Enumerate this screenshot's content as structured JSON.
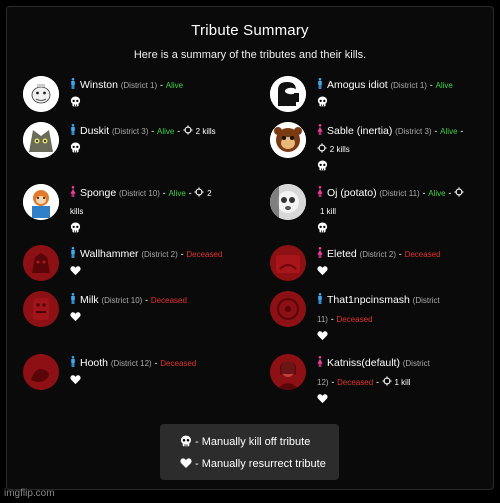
{
  "title": "Tribute Summary",
  "subtitle": "Here is a summary of the tributes and their kills.",
  "colors": {
    "alive": "#3fcf4a",
    "deceased": "#e23232",
    "male": "#3fa9f5",
    "female": "#f03c9a"
  },
  "tributes": [
    {
      "name": "Winston",
      "district": "(District 1)",
      "dash": "-",
      "status": "Alive",
      "dash2": "",
      "kills": "",
      "gender": "male",
      "icon": "skull-icon"
    },
    {
      "name": "Amogus idiot",
      "district": "(District 1)",
      "dash": "-",
      "status": "Alive",
      "dash2": "",
      "kills": "",
      "gender": "male",
      "icon": "skull-icon"
    },
    {
      "name": "Duskit",
      "district": "(District 3)",
      "dash": "-",
      "status": "Alive",
      "dash2": "-",
      "kills": "2 kills",
      "gender": "male",
      "icon": "skull-icon"
    },
    {
      "name": "Sable (inertia)",
      "district": "(District 3)",
      "dash": "-",
      "status": "Alive",
      "dash2": "-",
      "kills": "2 kills",
      "gender": "female",
      "icon": "skull-icon"
    },
    {
      "name": "Sponge",
      "district": "(District 10)",
      "dash": "-",
      "status": "Alive",
      "dash2": "-",
      "kills_a": "2",
      "kills_b": "kills",
      "gender": "female",
      "icon": "skull-icon"
    },
    {
      "name": "Oj (potato)",
      "district": "(District 11)",
      "dash": "-",
      "status": "Alive",
      "dash2": "-",
      "kills": "1 kill",
      "gender": "female",
      "icon": "skull-icon"
    },
    {
      "name": "Wallhammer",
      "district": "(District 2)",
      "dash": "-",
      "status": "Deceased",
      "gender": "male",
      "icon": "heart-icon"
    },
    {
      "name": "Eleted",
      "district": "(District 2)",
      "dash": "-",
      "status": "Deceased",
      "gender": "female",
      "icon": "heart-icon"
    },
    {
      "name": "Milk",
      "district": "(District 10)",
      "dash": "-",
      "status": "Deceased",
      "gender": "male",
      "icon": "heart-icon"
    },
    {
      "name": "That1npcinsmash",
      "district_a": "(District",
      "district_b": "11)",
      "dash": "-",
      "status": "Deceased",
      "gender": "male",
      "icon": "heart-icon"
    },
    {
      "name": "Hooth",
      "district": "(District 12)",
      "dash": "-",
      "status": "Deceased",
      "gender": "male",
      "icon": "heart-icon"
    },
    {
      "name": "Katniss(default)",
      "district_a": "(District",
      "district_b": "12)",
      "dash": "-",
      "status": "Deceased",
      "dash2": "-",
      "kills": "1 kill",
      "gender": "female",
      "icon": "heart-icon"
    }
  ],
  "legend": {
    "kill_label": "- Manually kill off tribute",
    "resurrect_label": "- Manually resurrect tribute"
  },
  "watermark": "imgflip.com"
}
